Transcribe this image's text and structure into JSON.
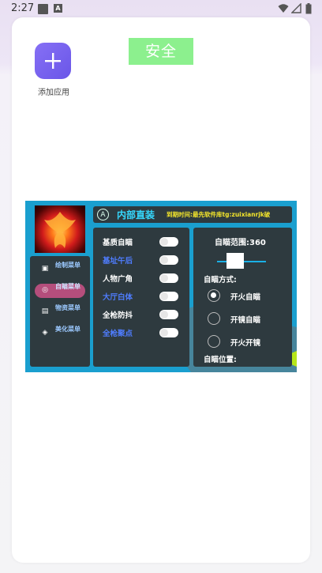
{
  "status_bar": {
    "time": "2:27",
    "badge_letter": "A",
    "icons": [
      "notification-square-icon",
      "a-badge-icon",
      "wifi-icon",
      "signal-icon",
      "battery-icon"
    ]
  },
  "home": {
    "add_app_label": "添加应用",
    "safe_badge": "安全",
    "safe_badge_color": "#8cf08e",
    "accent": "#7a63f2"
  },
  "mod_menu": {
    "title": "内部直装",
    "logo_letter": "A",
    "expire_text": "到期时间:最先软件库tg:zuixianrjk破",
    "nav": [
      {
        "label": "绘制菜单",
        "icon": "person-icon",
        "glyph": "▣",
        "active": false
      },
      {
        "label": "自瞄菜单",
        "icon": "crosshair-icon",
        "glyph": "◎",
        "active": true
      },
      {
        "label": "物资菜单",
        "icon": "inventory-icon",
        "glyph": "▤",
        "active": false
      },
      {
        "label": "美化菜单",
        "icon": "cube-icon",
        "glyph": "◈",
        "active": false
      }
    ],
    "toggles": [
      {
        "label": "基质自瞄",
        "on": false,
        "highlight": false
      },
      {
        "label": "基址午后",
        "on": false,
        "highlight": true
      },
      {
        "label": "人物广角",
        "on": false,
        "highlight": false
      },
      {
        "label": "大厅白体",
        "on": false,
        "highlight": true
      },
      {
        "label": "全枪防抖",
        "on": false,
        "highlight": false
      },
      {
        "label": "全枪聚点",
        "on": false,
        "highlight": true
      }
    ],
    "aim_range_label": "自瞄范围:360",
    "aim_range_value": 360,
    "aim_mode_label": "自瞄方式:",
    "aim_modes": [
      {
        "label": "开火自瞄",
        "selected": true
      },
      {
        "label": "开镜自瞄",
        "selected": false
      },
      {
        "label": "开火开镜",
        "selected": false
      }
    ],
    "aim_position_label": "自瞄位置:"
  }
}
